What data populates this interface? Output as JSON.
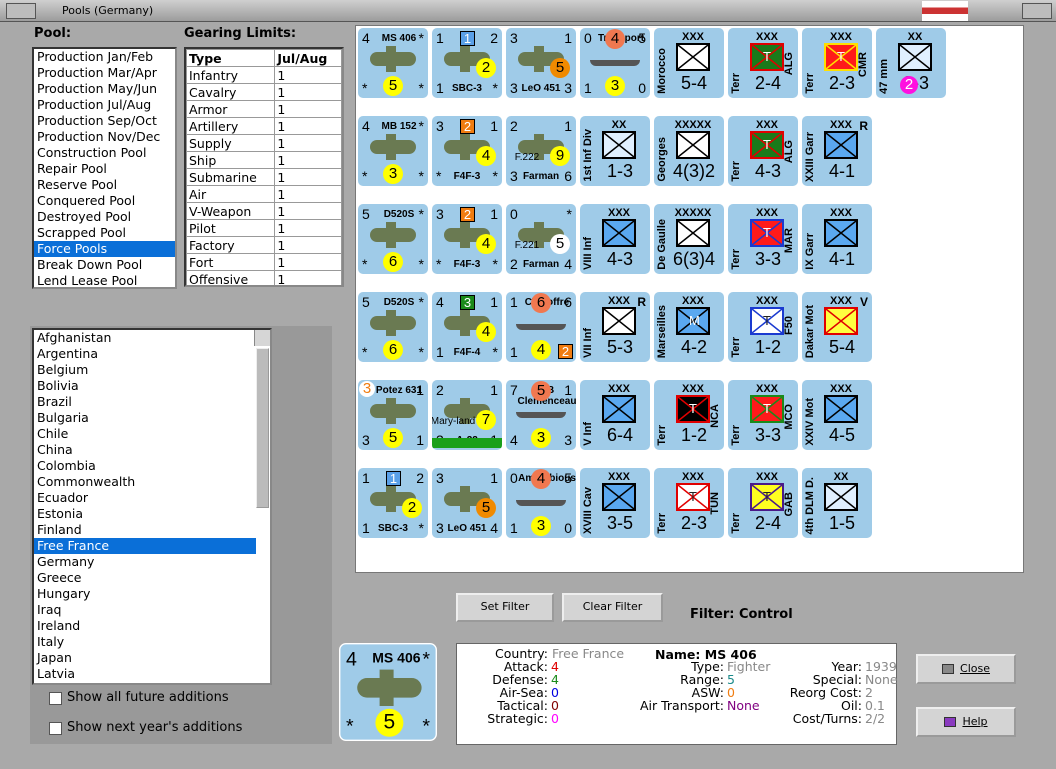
{
  "window": {
    "title": "Pools (Germany)"
  },
  "pool": {
    "label": "Pool:",
    "items": [
      "Production Jan/Feb",
      "Production Mar/Apr",
      "Production May/Jun",
      "Production Jul/Aug",
      "Production Sep/Oct",
      "Production Nov/Dec",
      "Construction Pool",
      "Repair Pool",
      "Reserve Pool",
      "Conquered Pool",
      "Destroyed Pool",
      "Scrapped Pool",
      "Force Pools",
      "Break Down Pool",
      "Lend Lease Pool"
    ],
    "selected": 12
  },
  "gearing": {
    "label": "Gearing Limits:",
    "headers": [
      "Type",
      "Jul/Aug"
    ],
    "rows": [
      [
        "Infantry",
        "1"
      ],
      [
        "Cavalry",
        "1"
      ],
      [
        "Armor",
        "1"
      ],
      [
        "Artillery",
        "1"
      ],
      [
        "Supply",
        "1"
      ],
      [
        "Ship",
        "1"
      ],
      [
        "Submarine",
        "1"
      ],
      [
        "Air",
        "1"
      ],
      [
        "V-Weapon",
        "1"
      ],
      [
        "Pilot",
        "1"
      ],
      [
        "Factory",
        "1"
      ],
      [
        "Fort",
        "1"
      ],
      [
        "Offensive",
        "1"
      ]
    ]
  },
  "countries": {
    "items": [
      "Afghanistan",
      "Argentina",
      "Belgium",
      "Bolivia",
      "Brazil",
      "Bulgaria",
      "Chile",
      "China",
      "Colombia",
      "Commonwealth",
      "Ecuador",
      "Estonia",
      "Finland",
      "Free France",
      "Germany",
      "Greece",
      "Hungary",
      "Iraq",
      "Ireland",
      "Italy",
      "Japan",
      "Latvia"
    ],
    "selected": 13
  },
  "options": {
    "future": "Show all future additions",
    "next_year": "Show next year's additions"
  },
  "filter": {
    "set": "Set Filter",
    "clear": "Clear Filter",
    "label": "Filter:  Control"
  },
  "buttons": {
    "close": "Close",
    "help": "Help"
  },
  "counters": [
    [
      {
        "k": "air",
        "tl": "4",
        "nm": "MS 406",
        "tr": "*",
        "bl": "*",
        "bc": "5",
        "br": "*"
      },
      {
        "k": "air",
        "tl": "1",
        "sq": "1",
        "sqc": "#5aa0e8",
        "tr": "2",
        "mid": "2",
        "bl": "1",
        "nm2": "SBC-3",
        "br": "*"
      },
      {
        "k": "air",
        "tl": "3",
        "tr": "1",
        "mid": "5",
        "midc": "#f08a00",
        "bl": "3",
        "nm2": "LeO 451",
        "br": "3"
      },
      {
        "k": "sea",
        "tl": "0",
        "tc": "4",
        "tr": "5",
        "nm": "Transport",
        "bl": "1",
        "bc": "3",
        "br": "0"
      },
      {
        "k": "land",
        "side": "Morocco",
        "size": "XXX",
        "str": "5-4",
        "fill": "#ffffff"
      },
      {
        "k": "land",
        "side": "Terr",
        "size": "XXX",
        "str": "2-4",
        "fill": "#1a7a1a",
        "edge": "#e00000",
        "rs": "ALG",
        "t": "T"
      },
      {
        "k": "land",
        "side": "Terr",
        "size": "XXX",
        "str": "2-3",
        "fill": "#ff1a1a",
        "edge": "#ffe000",
        "rs": "CMR",
        "t": "T"
      },
      {
        "k": "land",
        "side": "47 mm",
        "size": "XX",
        "str": "2-3",
        "fill": "#e0f0ff",
        "hl": "2"
      }
    ],
    [
      {
        "k": "air",
        "tl": "4",
        "nm": "MB 152",
        "tr": "*",
        "bl": "*",
        "bc": "3",
        "br": "*"
      },
      {
        "k": "air",
        "tl": "3",
        "sq": "2",
        "sqc": "#f07c10",
        "tr": "1",
        "mid": "4",
        "bl": "*",
        "nm2": "F4F-3",
        "br": "*"
      },
      {
        "k": "air",
        "tl": "2",
        "tr": "1",
        "lab": "F.222",
        "mid": "9",
        "bl": "3",
        "nm2": "Farman",
        "br": "6"
      },
      {
        "k": "land",
        "side": "1st Inf Div",
        "size": "XX",
        "str": "1-3",
        "fill": "#e0f0ff"
      },
      {
        "k": "land",
        "side": "Georges",
        "size": "XXXXX",
        "str": "4(3)2",
        "fill": "#ffffff"
      },
      {
        "k": "land",
        "side": "Terr",
        "size": "XXX",
        "str": "4-3",
        "fill": "#1a7a1a",
        "edge": "#e00000",
        "rs": "ALG",
        "t": "T"
      },
      {
        "k": "land",
        "side": "XXIII Garr",
        "size": "XXX",
        "str": "4-1",
        "fill": "#5aa8f0",
        "corner": "R"
      }
    ],
    [
      {
        "k": "air",
        "tl": "5",
        "nm": "D520S",
        "tr": "*",
        "bl": "*",
        "bc": "6",
        "br": "*"
      },
      {
        "k": "air",
        "tl": "3",
        "sq": "2",
        "sqc": "#f07c10",
        "tr": "1",
        "mid": "4",
        "bl": "*",
        "nm2": "F4F-3",
        "br": "*"
      },
      {
        "k": "air",
        "tl": "0",
        "tr": "*",
        "lab": "F.221",
        "mid": "5",
        "midc": "#ffffff",
        "bl": "2",
        "nm2": "Farman",
        "br": "4"
      },
      {
        "k": "land",
        "side": "VIII Inf",
        "size": "XXX",
        "str": "4-3",
        "fill": "#5aa8f0"
      },
      {
        "k": "land",
        "side": "De Gaulle",
        "size": "XXXXX",
        "str": "6(3)4",
        "fill": "#ffffff"
      },
      {
        "k": "land",
        "side": "Terr",
        "size": "XXX",
        "str": "3-3",
        "fill": "#ff1a1a",
        "edge": "#1a3ad0",
        "rs": "MAR",
        "t": "T"
      },
      {
        "k": "land",
        "side": "IX Garr",
        "size": "XXX",
        "str": "4-1",
        "fill": "#5aa8f0"
      }
    ],
    [
      {
        "k": "air",
        "tl": "5",
        "nm": "D520S",
        "tr": "*",
        "bl": "*",
        "bc": "6",
        "br": "*"
      },
      {
        "k": "air",
        "tl": "4",
        "sq": "3",
        "sqc": "#1a8a1a",
        "tr": "1",
        "mid": "4",
        "bl": "1",
        "nm2": "F4F-4",
        "br": "*"
      },
      {
        "k": "sea",
        "tl": "1",
        "tc": "6",
        "tr": "6",
        "nm": "CV Joffre",
        "bl": "1",
        "bc": "4",
        "brsq": "2"
      },
      {
        "k": "land",
        "side": "VII Inf",
        "size": "XXX",
        "str": "5-3",
        "fill": "#ffffff",
        "corner": "R"
      },
      {
        "k": "land",
        "side": "Marseilles",
        "size": "XXX",
        "str": "4-2",
        "fill": "#5aa8f0",
        "t": "M"
      },
      {
        "k": "land",
        "side": "Terr",
        "size": "XXX",
        "str": "1-2",
        "fill": "#ffffff",
        "edge": "#1a3ad0",
        "rs": "F50",
        "t": "T"
      },
      {
        "k": "land",
        "side": "Dakar Mot",
        "size": "XXX",
        "str": "5-4",
        "fill": "#ffff40",
        "edge": "#e00000",
        "corner": "V"
      }
    ],
    [
      {
        "k": "air",
        "tlc": "3",
        "nm": "Potez 631",
        "tr": "1",
        "bl": "3",
        "bc": "5",
        "br": "1"
      },
      {
        "k": "air",
        "tl": "2",
        "tr": "1",
        "lab": "Mary-land",
        "mid": "7",
        "bl": "3",
        "nm2": "A-22",
        "br": "1",
        "bar": "#1aa01a"
      },
      {
        "k": "sea",
        "tl": "7",
        "tc": "5",
        "tr": "1",
        "nm": "BB Clemenceau",
        "bl": "4",
        "bc": "3",
        "br": "3"
      },
      {
        "k": "land",
        "side": "V Inf",
        "size": "XXX",
        "str": "6-4",
        "fill": "#5aa8f0"
      },
      {
        "k": "land",
        "side": "Terr",
        "size": "XXX",
        "str": "1-2",
        "fill": "#000000",
        "edge": "#e00000",
        "rs": "NCA",
        "t": "T"
      },
      {
        "k": "land",
        "side": "Terr",
        "size": "XXX",
        "str": "3-3",
        "fill": "#ff1a1a",
        "edge": "#1a8a1a",
        "rs": "MCO",
        "t": "T"
      },
      {
        "k": "land",
        "side": "XXIV Mot",
        "size": "XXX",
        "str": "4-5",
        "fill": "#5aa8f0"
      }
    ],
    [
      {
        "k": "air",
        "tl": "1",
        "sq": "1",
        "sqc": "#5aa0e8",
        "tr": "2",
        "mid": "2",
        "bl": "1",
        "nm2": "SBC-3",
        "br": "*"
      },
      {
        "k": "air",
        "tl": "3",
        "tr": "1",
        "mid": "5",
        "midc": "#f08a00",
        "bl": "3",
        "nm2": "LeO 451",
        "br": "4"
      },
      {
        "k": "sea",
        "tl": "0",
        "tc": "4",
        "tr": "5",
        "nm": "Amphibious",
        "bl": "1",
        "bc": "3",
        "br": "0"
      },
      {
        "k": "land",
        "side": "XVIII Cav",
        "size": "XXX",
        "str": "3-5",
        "fill": "#5aa8f0"
      },
      {
        "k": "land",
        "side": "Terr",
        "size": "XXX",
        "str": "2-3",
        "fill": "#ffffff",
        "edge": "#e00000",
        "rs": "TUN",
        "t": "T"
      },
      {
        "k": "land",
        "side": "Terr",
        "size": "XXX",
        "str": "2-4",
        "fill": "#ffff20",
        "edge": "#4a1a8a",
        "rs": "GAB",
        "t": "T"
      },
      {
        "k": "land",
        "side": "4th DLM D.",
        "size": "XX",
        "str": "1-5",
        "fill": "#e0f0ff"
      }
    ]
  ],
  "selected_counter": {
    "tl": "4",
    "nm": "MS 406",
    "tr": "*",
    "bl": "*",
    "bc": "5",
    "br": "*"
  },
  "info": {
    "country": {
      "k": "Country:",
      "v": "Free France"
    },
    "name": "Name: MS 406",
    "attack": {
      "k": "Attack:",
      "v": "4"
    },
    "defense": {
      "k": "Defense:",
      "v": "4"
    },
    "airsea": {
      "k": "Air-Sea:",
      "v": "0"
    },
    "tactical": {
      "k": "Tactical:",
      "v": "0"
    },
    "strategic": {
      "k": "Strategic:",
      "v": "0"
    },
    "type": {
      "k": "Type:",
      "v": "Fighter"
    },
    "range": {
      "k": "Range:",
      "v": "5"
    },
    "asw": {
      "k": "ASW:",
      "v": "0"
    },
    "airtrans": {
      "k": "Air Transport:",
      "v": "None"
    },
    "year": {
      "k": "Year:",
      "v": "1939"
    },
    "special": {
      "k": "Special:",
      "v": "None"
    },
    "reorg": {
      "k": "Reorg Cost:",
      "v": "2"
    },
    "oil": {
      "k": "Oil:",
      "v": "0.1"
    },
    "cost": {
      "k": "Cost/Turns:",
      "v": "2/2"
    }
  }
}
